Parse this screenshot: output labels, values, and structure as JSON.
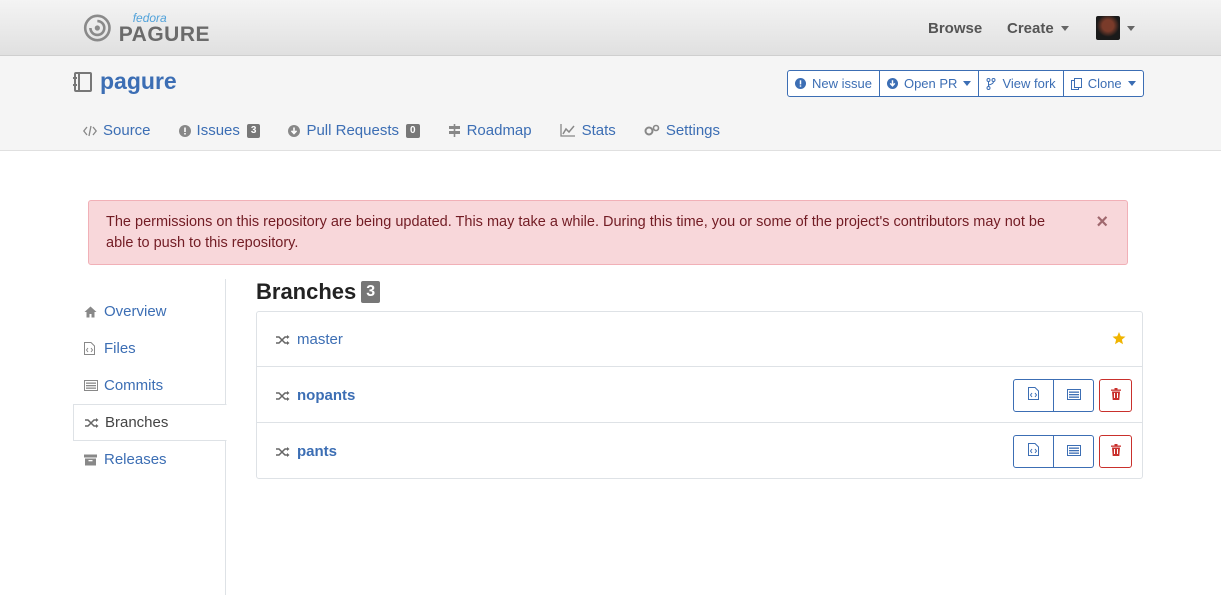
{
  "brand": {
    "small": "fedora",
    "large": "PAGURE"
  },
  "topnav": {
    "browse": "Browse",
    "create": "Create"
  },
  "repo": {
    "name": "pagure",
    "actions": {
      "new_issue": "New issue",
      "open_pr": "Open PR",
      "view_fork": "View fork",
      "clone": "Clone"
    },
    "tabs": [
      {
        "label": "Source",
        "icon": "code-icon"
      },
      {
        "label": "Issues",
        "count": "3",
        "icon": "exclamation-circle-icon"
      },
      {
        "label": "Pull Requests",
        "count": "0",
        "icon": "arrow-circle-down-icon"
      },
      {
        "label": "Roadmap",
        "icon": "signpost-icon"
      },
      {
        "label": "Stats",
        "icon": "line-chart-icon"
      },
      {
        "label": "Settings",
        "icon": "gears-icon"
      }
    ]
  },
  "alert": {
    "message": "The permissions on this repository are being updated. This may take a while. During this time, you or some of the project's contributors may not be able to push to this repository.",
    "close": "×"
  },
  "sidebar": {
    "items": [
      {
        "label": "Overview",
        "icon": "home-icon"
      },
      {
        "label": "Files",
        "icon": "file-code-icon"
      },
      {
        "label": "Commits",
        "icon": "list-icon"
      },
      {
        "label": "Branches",
        "icon": "random-icon",
        "active": true
      },
      {
        "label": "Releases",
        "icon": "archive-icon"
      }
    ]
  },
  "branches": {
    "title": "Branches",
    "count": "3",
    "items": [
      {
        "name": "master",
        "default": true
      },
      {
        "name": "nopants",
        "default": false
      },
      {
        "name": "pants",
        "default": false
      }
    ]
  },
  "colors": {
    "link": "#3c6eb4",
    "alert_bg": "#f8d7da",
    "alert_text": "#721c24",
    "star": "#f0b400",
    "delete": "#c9302c"
  }
}
